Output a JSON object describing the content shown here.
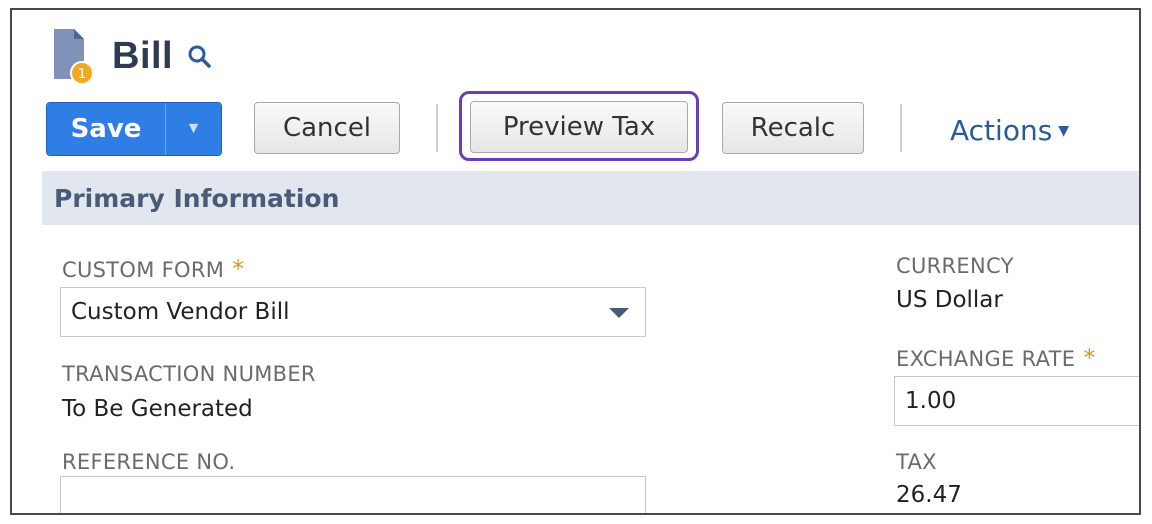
{
  "header": {
    "title": "Bill"
  },
  "toolbar": {
    "save_label": "Save",
    "cancel_label": "Cancel",
    "preview_tax_label": "Preview Tax",
    "recalc_label": "Recalc",
    "actions_label": "Actions"
  },
  "section": {
    "title": "Primary Information"
  },
  "fields": {
    "custom_form": {
      "label": "CUSTOM FORM",
      "required": "*",
      "value": "Custom Vendor Bill"
    },
    "transaction_number": {
      "label": "TRANSACTION NUMBER",
      "value": "To Be Generated"
    },
    "reference_no": {
      "label": "REFERENCE NO.",
      "value": ""
    },
    "currency": {
      "label": "CURRENCY",
      "value": "US Dollar"
    },
    "exchange_rate": {
      "label": "EXCHANGE RATE",
      "required": "*",
      "value": "1.00"
    },
    "tax": {
      "label": "TAX",
      "value": "26.47"
    }
  },
  "colors": {
    "save_blue": "#2f7ee6",
    "highlight_purple": "#6a3dbd",
    "required_orange": "#d89a2b",
    "section_bg": "#e2e7ef"
  },
  "icons": {
    "page": "bill-document-icon",
    "search": "search-icon",
    "save_menu": "chevron-down-icon",
    "actions_menu": "caret-down-icon",
    "dropdown": "dropdown-arrow-icon"
  }
}
